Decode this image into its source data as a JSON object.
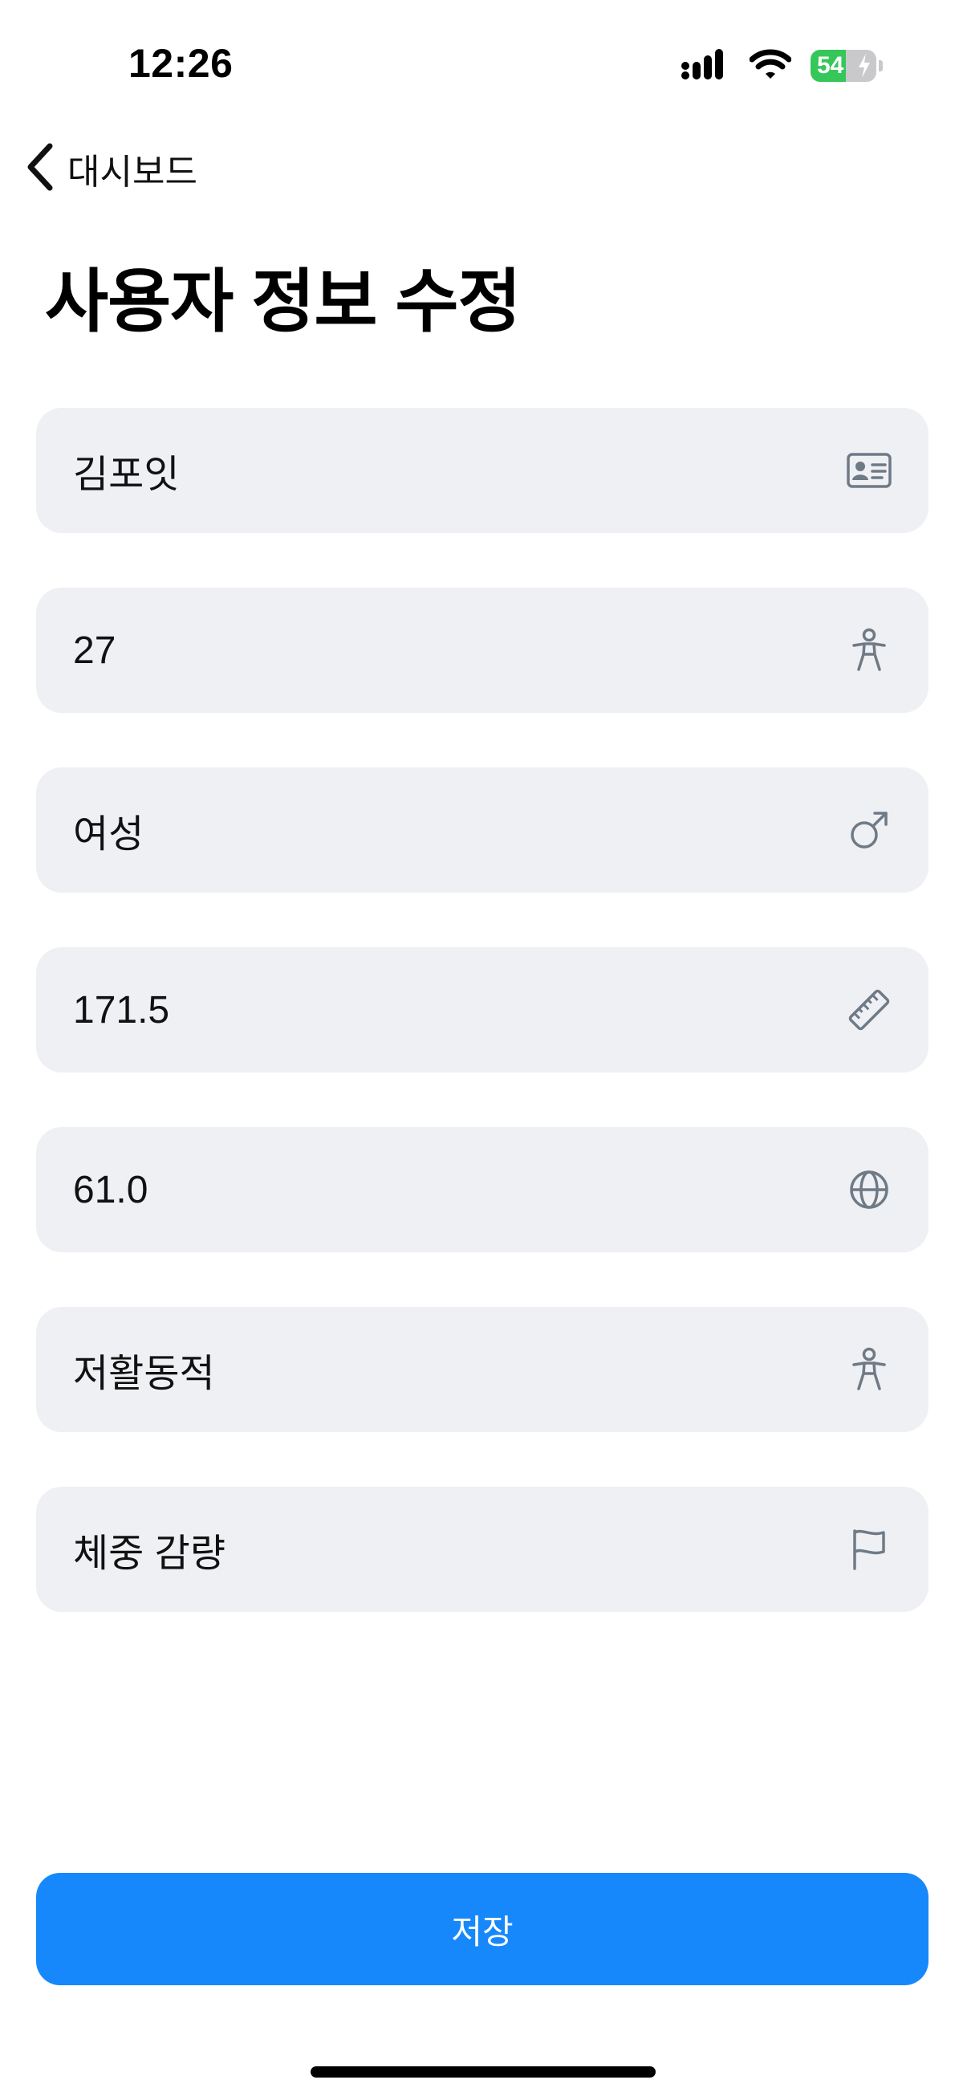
{
  "status_bar": {
    "time": "12:26",
    "battery_level": "54",
    "battery_fraction": 0.54
  },
  "nav": {
    "back_label": "대시보드"
  },
  "page": {
    "title": "사용자 정보 수정"
  },
  "fields": [
    {
      "value": "김포잇",
      "icon": "id-card-icon"
    },
    {
      "value": "27",
      "icon": "person-icon"
    },
    {
      "value": "여성",
      "icon": "male-symbol-icon"
    },
    {
      "value": "171.5",
      "icon": "ruler-icon"
    },
    {
      "value": "61.0",
      "icon": "globe-icon"
    },
    {
      "value": "저활동적",
      "icon": "person-icon"
    },
    {
      "value": "체중 감량",
      "icon": "flag-icon"
    }
  ],
  "actions": {
    "save_label": "저장"
  },
  "colors": {
    "accent": "#1688fb",
    "field_background": "#eff0f4",
    "icon_gray": "#6e7a86",
    "battery_green": "#35c759"
  }
}
